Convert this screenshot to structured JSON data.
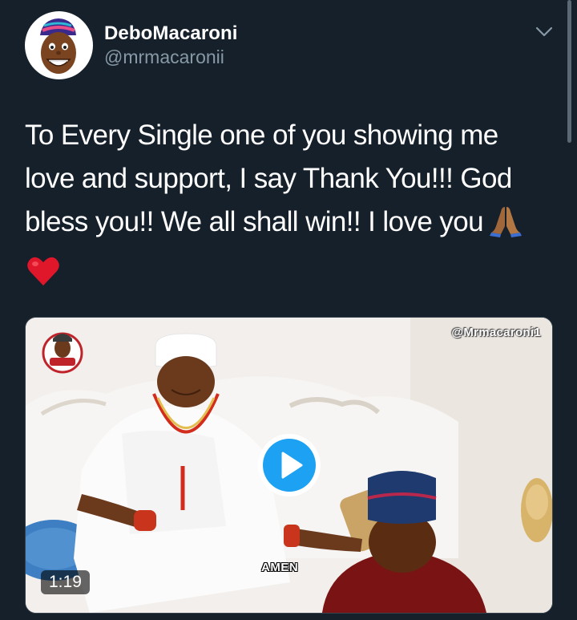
{
  "author": {
    "name": "DeboMacaroni",
    "handle": "@mrmacaronii"
  },
  "tweet": {
    "lines": [
      "To Every Single one of you showing me",
      "love and support, I say Thank You!!! God",
      "bless you!! We all shall win!! I love you"
    ],
    "emojis": [
      "folded-hands-emoji",
      "red-heart-emoji"
    ]
  },
  "media": {
    "watermark": "@Mrmacaroni1",
    "caption": "AMEN",
    "duration": "1:19",
    "logo_text": "Mr Macaroni"
  },
  "colors": {
    "background": "#15202b",
    "text": "#ffffff",
    "secondary_text": "#8899a6",
    "accent": "#1da1f2"
  },
  "icons": {
    "menu": "chevron-down-icon",
    "play": "play-icon"
  }
}
